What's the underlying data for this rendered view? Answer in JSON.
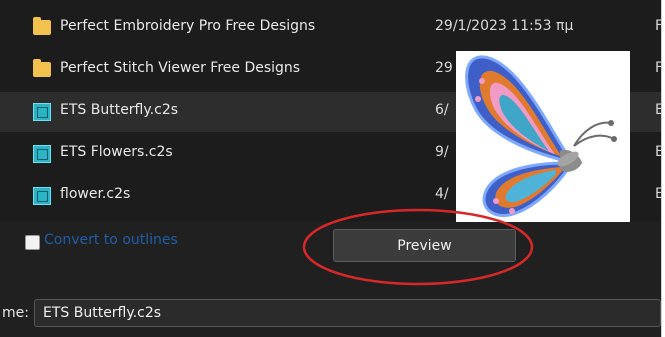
{
  "files": [
    {
      "name": "Perfect Embroidery Pro Free Designs",
      "date": "29/1/2023 11:53 πμ",
      "col3": "F",
      "type": "folder",
      "selected": false
    },
    {
      "name": "Perfect Stitch Viewer Free Designs",
      "date": "29",
      "col3": "F",
      "type": "folder",
      "selected": false
    },
    {
      "name": "ETS Butterfly.c2s",
      "date": "6/",
      "col3": "E",
      "type": "c2s",
      "selected": true
    },
    {
      "name": "ETS Flowers.c2s",
      "date": "9/",
      "col3": "E",
      "type": "c2s",
      "selected": false
    },
    {
      "name": "flower.c2s",
      "date": "4/",
      "col3": "E",
      "type": "c2s",
      "selected": false
    }
  ],
  "options": {
    "convert_label": "Convert to outlines",
    "convert_checked": false
  },
  "preview_button": "Preview",
  "filename": {
    "label": "me:",
    "value": "ETS Butterfly.c2s"
  },
  "colors": {
    "highlight": "#d62828",
    "link": "#1e5ea8",
    "folder": "#f2c14e",
    "c2s": "#2bb3c6"
  },
  "icons": {
    "folder": "folder-icon",
    "c2s": "c2s-file-icon"
  }
}
